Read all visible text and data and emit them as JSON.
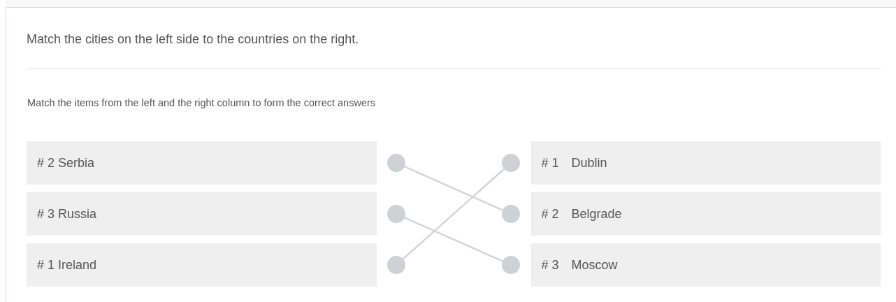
{
  "question": "Match the cities on the left side to the countries on the right.",
  "instruction": "Match the items from the left and the right column to form the correct answers",
  "left_items": [
    {
      "label": "# 2 Serbia",
      "kind": "down1"
    },
    {
      "label": "# 3 Russia",
      "kind": "down1"
    },
    {
      "label": "# 1 Ireland",
      "kind": "up2"
    }
  ],
  "right_items": [
    {
      "number": "# 1",
      "label": "Dublin"
    },
    {
      "number": "# 2",
      "label": "Belgrade"
    },
    {
      "number": "# 3",
      "label": "Moscow"
    }
  ]
}
